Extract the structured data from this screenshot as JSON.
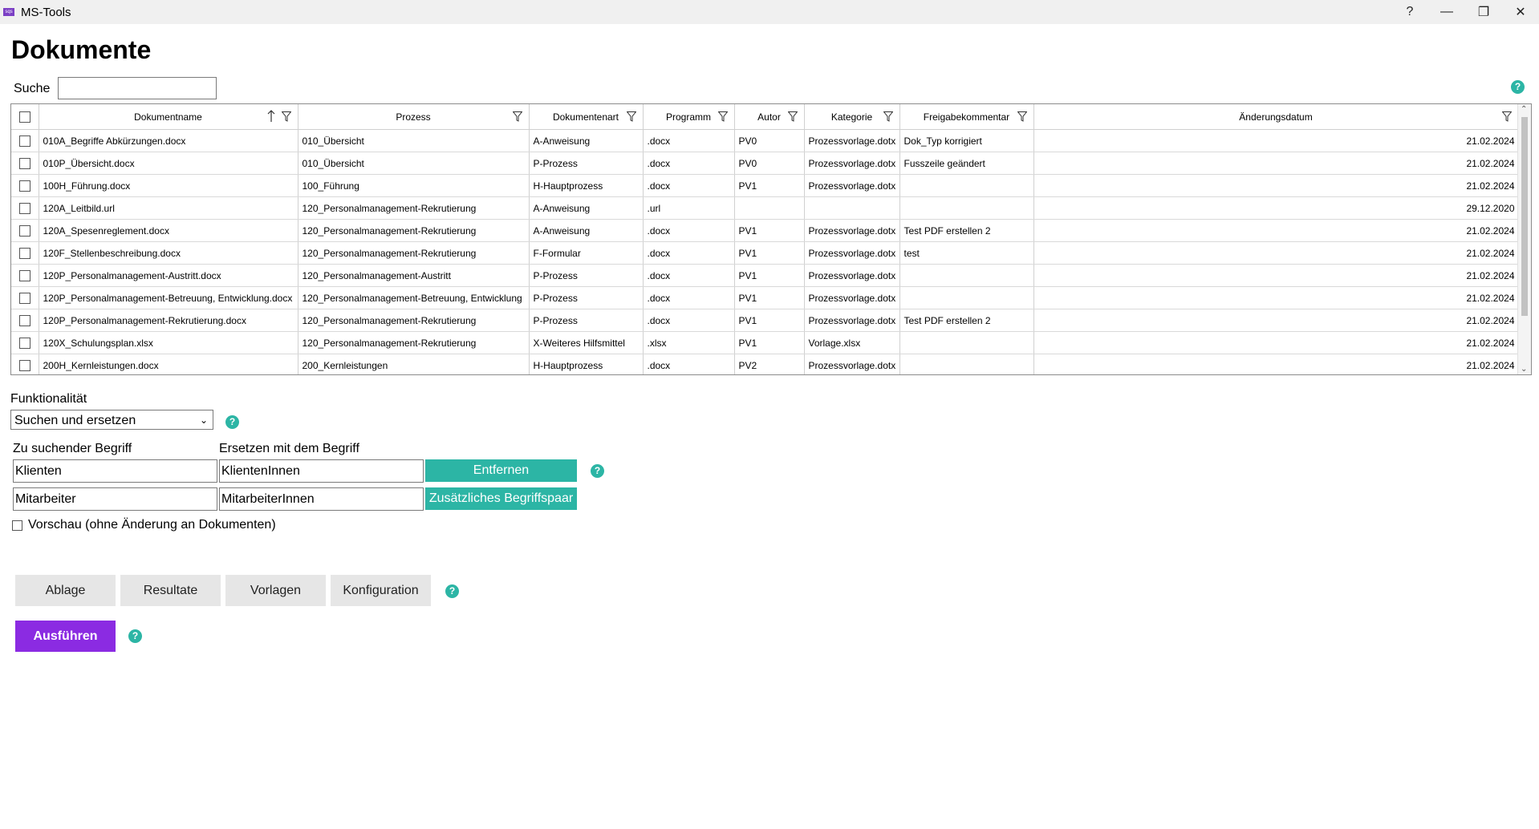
{
  "window": {
    "icon_text": "sqs",
    "title": "MS-Tools",
    "help": "?",
    "minimize": "—",
    "restore": "❐",
    "close": "✕"
  },
  "page": {
    "title": "Dokumente",
    "search_label": "Suche",
    "search_value": ""
  },
  "help_icon": "?",
  "table": {
    "columns": [
      "Dokumentname",
      "Prozess",
      "Dokumentenart",
      "Programm",
      "Autor",
      "Kategorie",
      "Freigabekommentar",
      "Änderungsdatum"
    ],
    "sorted_column": "Dokumentname",
    "sort_direction": "ascending",
    "rows": [
      {
        "name": "010A_Begriffe Abkürzungen.docx",
        "prozess": "010_Übersicht",
        "art": "A-Anweisung",
        "programm": ".docx",
        "autor": "PV0",
        "kategorie": "Prozessvorlage.dotx",
        "kommentar": "Dok_Typ korrigiert",
        "datum": "21.02.2024"
      },
      {
        "name": "010P_Übersicht.docx",
        "prozess": "010_Übersicht",
        "art": "P-Prozess",
        "programm": ".docx",
        "autor": "PV0",
        "kategorie": "Prozessvorlage.dotx",
        "kommentar": "Fusszeile geändert",
        "datum": "21.02.2024"
      },
      {
        "name": "100H_Führung.docx",
        "prozess": "100_Führung",
        "art": "H-Hauptprozess",
        "programm": ".docx",
        "autor": "PV1",
        "kategorie": "Prozessvorlage.dotx",
        "kommentar": "",
        "datum": "21.02.2024"
      },
      {
        "name": "120A_Leitbild.url",
        "prozess": "120_Personalmanagement-Rekrutierung",
        "art": "A-Anweisung",
        "programm": ".url",
        "autor": "",
        "kategorie": "",
        "kommentar": "",
        "datum": "29.12.2020"
      },
      {
        "name": "120A_Spesenreglement.docx",
        "prozess": "120_Personalmanagement-Rekrutierung",
        "art": "A-Anweisung",
        "programm": ".docx",
        "autor": "PV1",
        "kategorie": "Prozessvorlage.dotx",
        "kommentar": "Test PDF erstellen 2",
        "datum": "21.02.2024"
      },
      {
        "name": "120F_Stellenbeschreibung.docx",
        "prozess": "120_Personalmanagement-Rekrutierung",
        "art": "F-Formular",
        "programm": ".docx",
        "autor": "PV1",
        "kategorie": "Prozessvorlage.dotx",
        "kommentar": "test",
        "datum": "21.02.2024"
      },
      {
        "name": "120P_Personalmanagement-Austritt.docx",
        "prozess": "120_Personalmanagement-Austritt",
        "art": "P-Prozess",
        "programm": ".docx",
        "autor": "PV1",
        "kategorie": "Prozessvorlage.dotx",
        "kommentar": "",
        "datum": "21.02.2024"
      },
      {
        "name": "120P_Personalmanagement-Betreuung, Entwicklung.docx",
        "prozess": "120_Personalmanagement-Betreuung, Entwicklung",
        "art": "P-Prozess",
        "programm": ".docx",
        "autor": "PV1",
        "kategorie": "Prozessvorlage.dotx",
        "kommentar": "",
        "datum": "21.02.2024"
      },
      {
        "name": "120P_Personalmanagement-Rekrutierung.docx",
        "prozess": "120_Personalmanagement-Rekrutierung",
        "art": "P-Prozess",
        "programm": ".docx",
        "autor": "PV1",
        "kategorie": "Prozessvorlage.dotx",
        "kommentar": "Test PDF erstellen 2",
        "datum": "21.02.2024"
      },
      {
        "name": "120X_Schulungsplan.xlsx",
        "prozess": "120_Personalmanagement-Rekrutierung",
        "art": "X-Weiteres Hilfsmittel",
        "programm": ".xlsx",
        "autor": "PV1",
        "kategorie": "Vorlage.xlsx",
        "kommentar": "",
        "datum": "21.02.2024"
      },
      {
        "name": "200H_Kernleistungen.docx",
        "prozess": "200_Kernleistungen",
        "art": "H-Hauptprozess",
        "programm": ".docx",
        "autor": "PV2",
        "kategorie": "Prozessvorlage.dotx",
        "kommentar": "",
        "datum": "21.02.2024"
      }
    ]
  },
  "function": {
    "label": "Funktionalität",
    "selected": "Suchen und ersetzen",
    "search_term_label": "Zu suchender Begriff",
    "replace_term_label": "Ersetzen mit dem Begriff",
    "pairs": [
      {
        "search": "Klienten",
        "replace": "KlientenInnen"
      },
      {
        "search": "Mitarbeiter",
        "replace": "MitarbeiterInnen"
      }
    ],
    "remove_button": "Entfernen",
    "add_pair_button": "Zusätzliches Begriffspaar",
    "preview_label": "Vorschau (ohne Änderung an Dokumenten)",
    "preview_checked": false
  },
  "tabs": [
    "Ablage",
    "Resultate",
    "Vorlagen",
    "Konfiguration"
  ],
  "run_button": "Ausführen",
  "colors": {
    "teal": "#2cb5a5",
    "purple": "#8b2be2",
    "titlebar": "#f0f0f0"
  }
}
